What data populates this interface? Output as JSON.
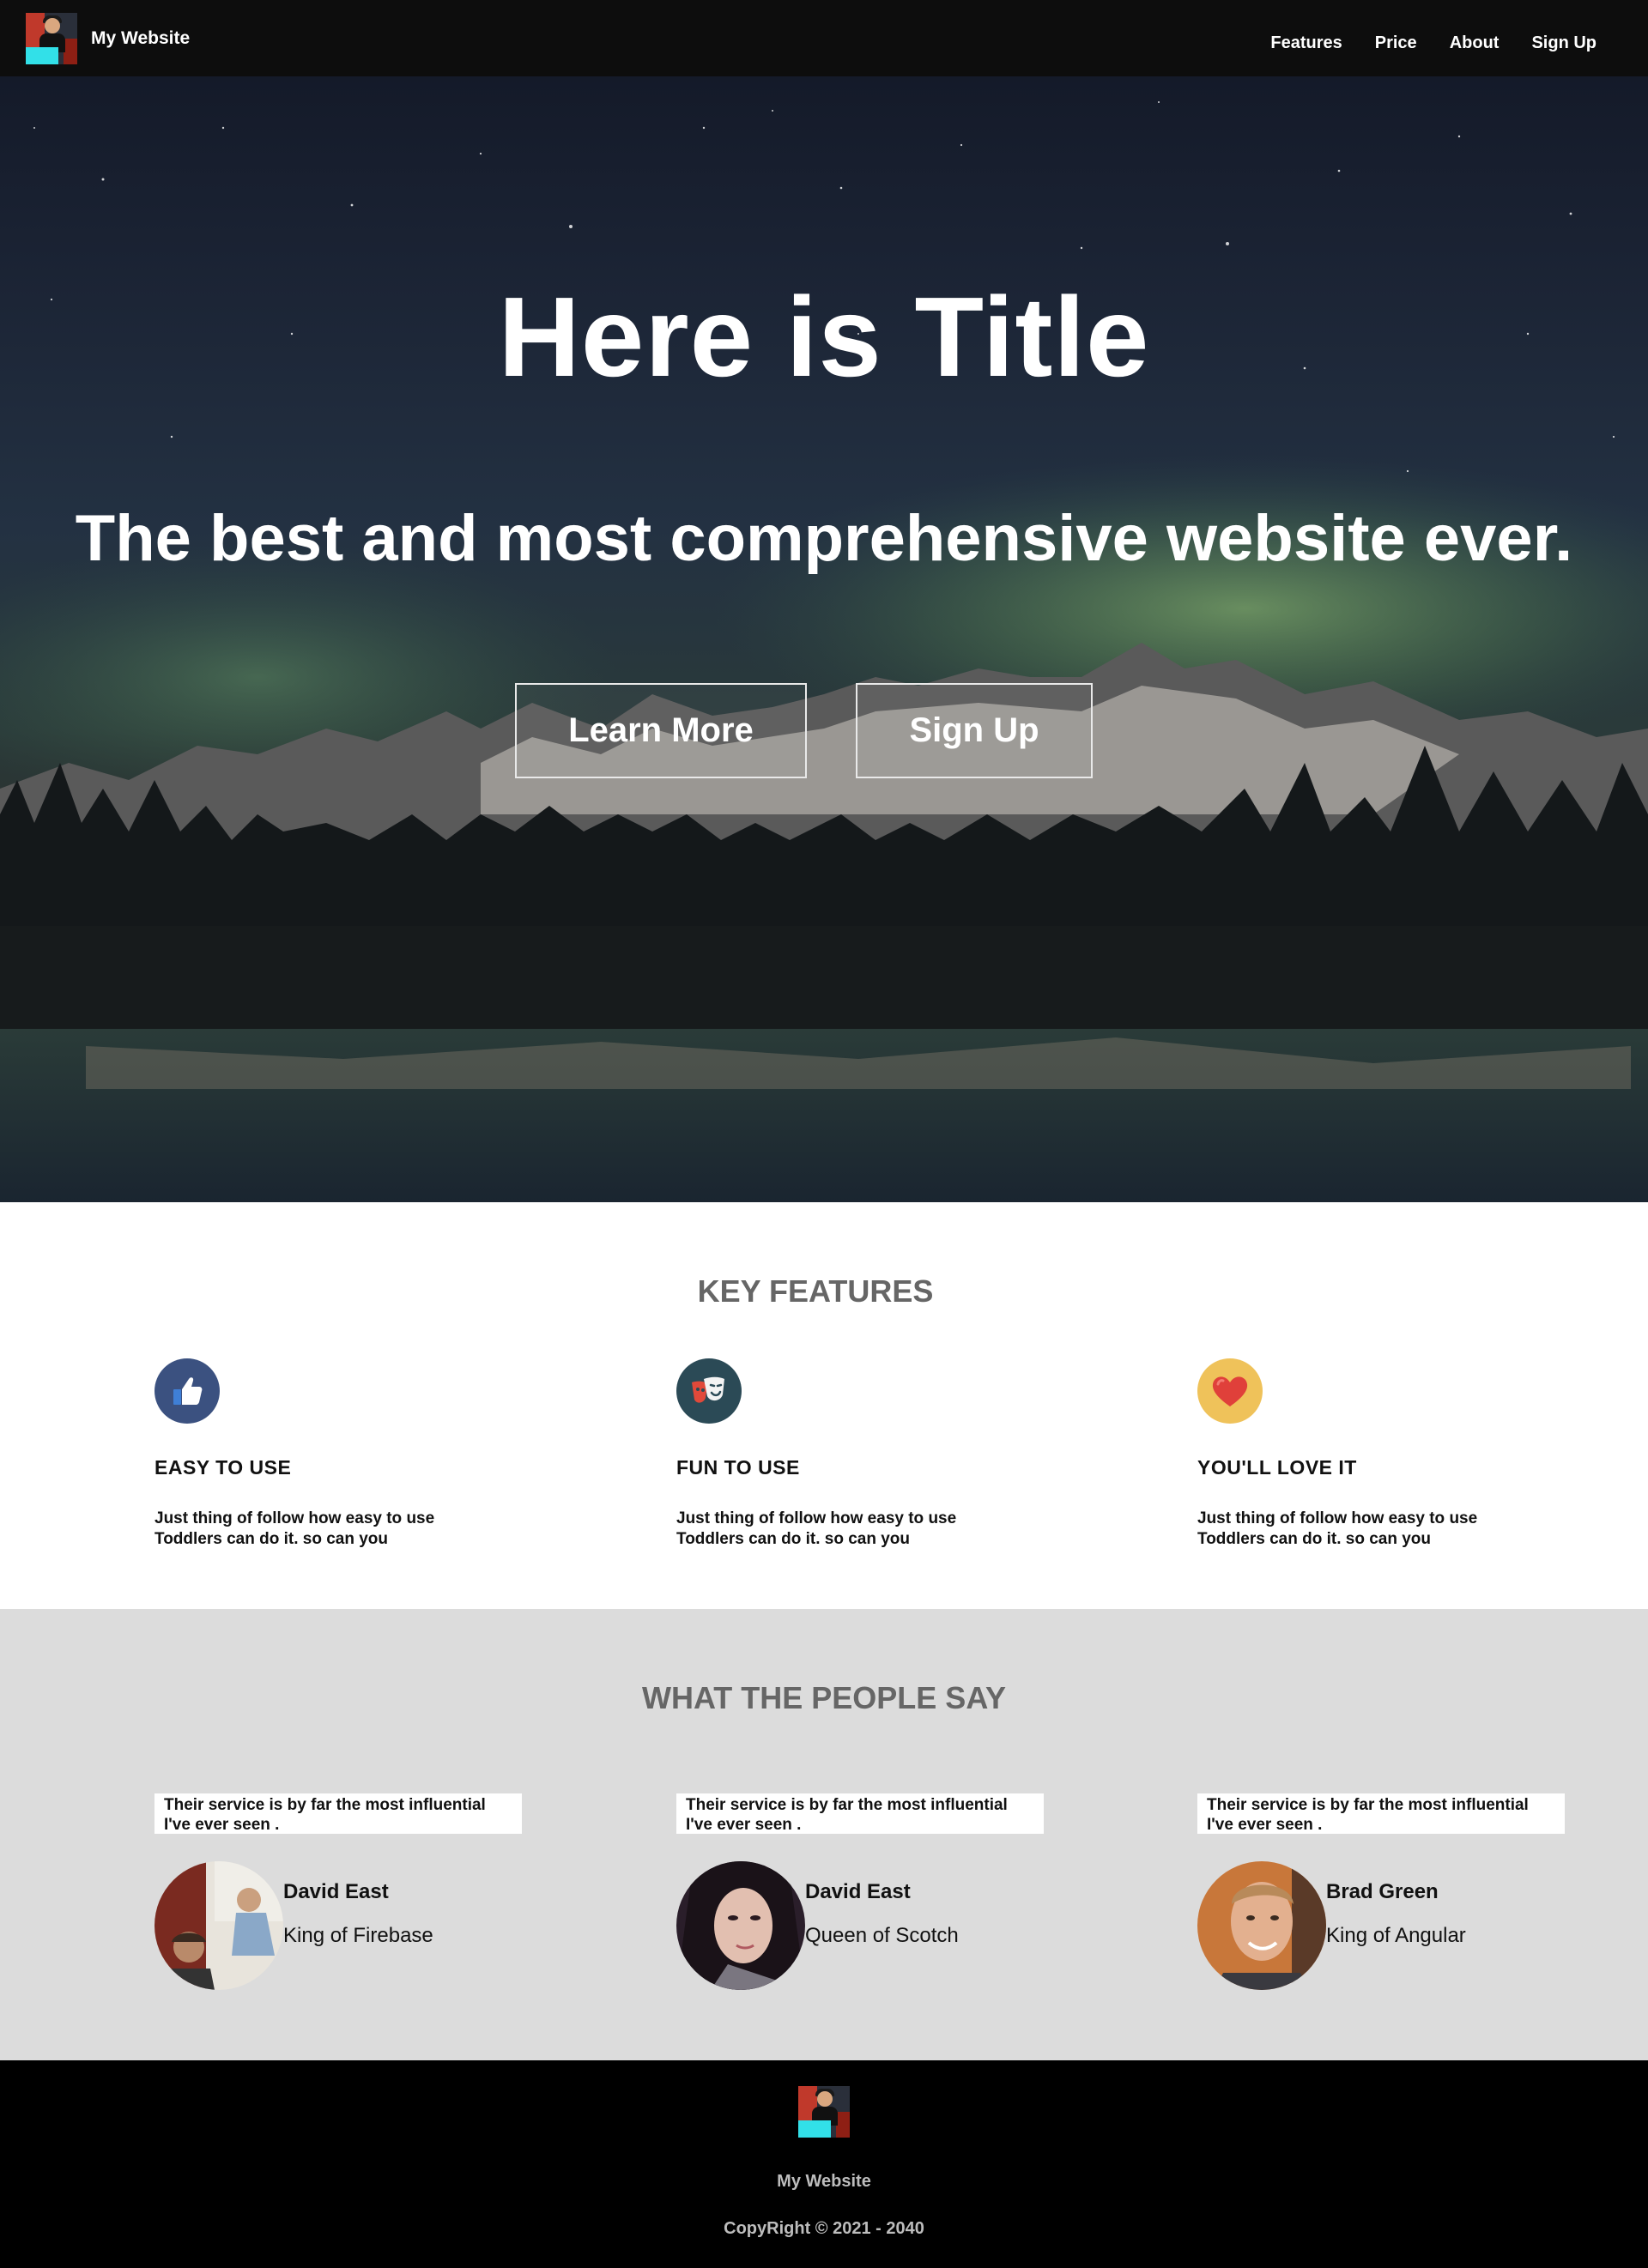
{
  "navbar": {
    "brand": "My Website",
    "links": [
      "Features",
      "Price",
      "About",
      "Sign Up"
    ]
  },
  "hero": {
    "title": "Here is Title",
    "subtitle": "The best and most comprehensive website ever.",
    "learn_more": "Learn More",
    "sign_up": "Sign Up"
  },
  "features": {
    "heading": "KEY FEATURES",
    "items": [
      {
        "title": "EASY TO USE",
        "text": "Just thing of follow how easy to use Toddlers can do it. so can you",
        "icon": "thumbs-up-icon",
        "color": "#3b5180"
      },
      {
        "title": "FUN TO USE",
        "text": "Just thing of follow how easy to use Toddlers can do it. so can you",
        "icon": "theater-masks-icon",
        "color": "#2b4a56"
      },
      {
        "title": "YOU'LL LOVE IT",
        "text": "Just thing of follow how easy to use Toddlers can do it. so can you",
        "icon": "heart-icon",
        "color": "#efc25a"
      }
    ]
  },
  "testimonials": {
    "heading": "WHAT THE PEOPLE SAY",
    "items": [
      {
        "quote": "Their service is by far the most influential I've ever seen .",
        "name": "David East",
        "role": "King of Firebase"
      },
      {
        "quote": "Their service is by far the most influential I've ever seen .",
        "name": "David East",
        "role": "Queen of Scotch"
      },
      {
        "quote": "Their service is by far the most influential I've ever seen .",
        "name": "Brad Green",
        "role": "King of Angular"
      }
    ]
  },
  "footer": {
    "brand": "My Website",
    "copyright": "CopyRight © 2021 - 2040"
  }
}
